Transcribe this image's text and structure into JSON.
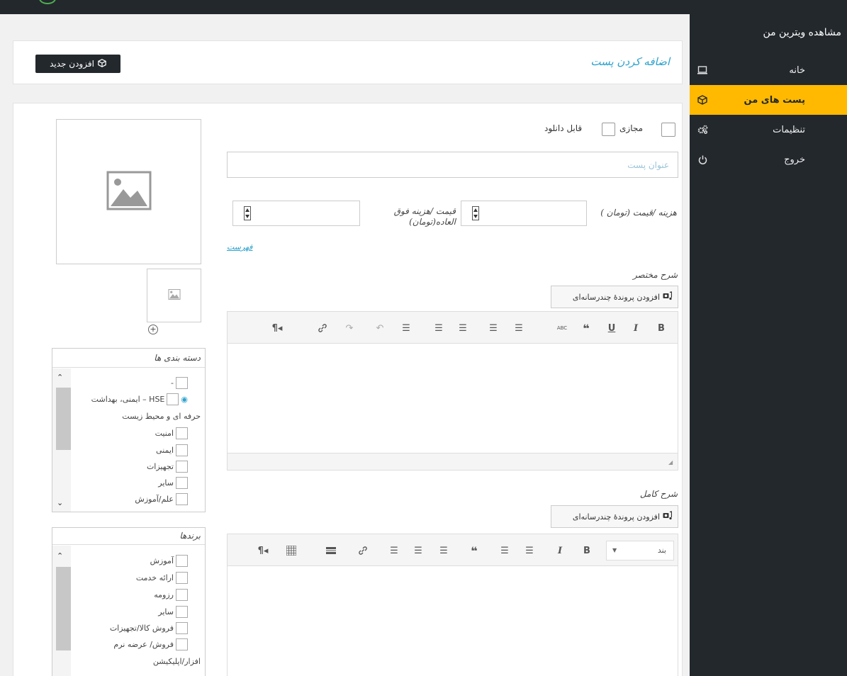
{
  "sidebar": {
    "store_link": "مشاهده ویترین من",
    "items": [
      {
        "label": "خانه",
        "icon": "laptop-icon",
        "active": false
      },
      {
        "label": "پست های من",
        "icon": "cube-icon",
        "active": true
      },
      {
        "label": "تنظیمات",
        "icon": "gears-icon",
        "active": false
      },
      {
        "label": "خروج",
        "icon": "power-icon",
        "active": false
      }
    ]
  },
  "header": {
    "title": "اضافه کردن پست",
    "add_new_label": "افزودن جدید"
  },
  "form": {
    "virtual_label": "مجازی",
    "downloadable_label": "قابل دانلود",
    "title_placeholder": "عنوان پست",
    "price_label": "هزینه /قیمت (تومان )",
    "sale_price_label": "قیمت /هزینه فوق العاده(تومان)",
    "schedule_link": "فهرست",
    "short_desc_label": "شرح مختصر",
    "full_desc_label": "شرح کامل",
    "add_media_label": "افزودن پروندهٔ چندرسانه‌ای",
    "format_select_value": "بند"
  },
  "categories": {
    "title": "دسته بندی ها",
    "items": [
      "-",
      "HSE – ایمنی، بهداشت",
      "حرفه ای و محیط زیست",
      "امنیت",
      "ایمنی",
      "تجهیزات",
      "سایر",
      "علم/آموزش"
    ]
  },
  "tags": {
    "title": "برندها",
    "items": [
      "آموزش",
      "ارائه خدمت",
      "رزومه",
      "سایر",
      "فروش کالا/تجهیزات",
      "فروش/ عرضه نرم",
      "افزار/اپلیکیشن"
    ]
  },
  "colors": {
    "accent": "#ffb900",
    "dark": "#23282d",
    "heading": "#2ea2cc"
  }
}
